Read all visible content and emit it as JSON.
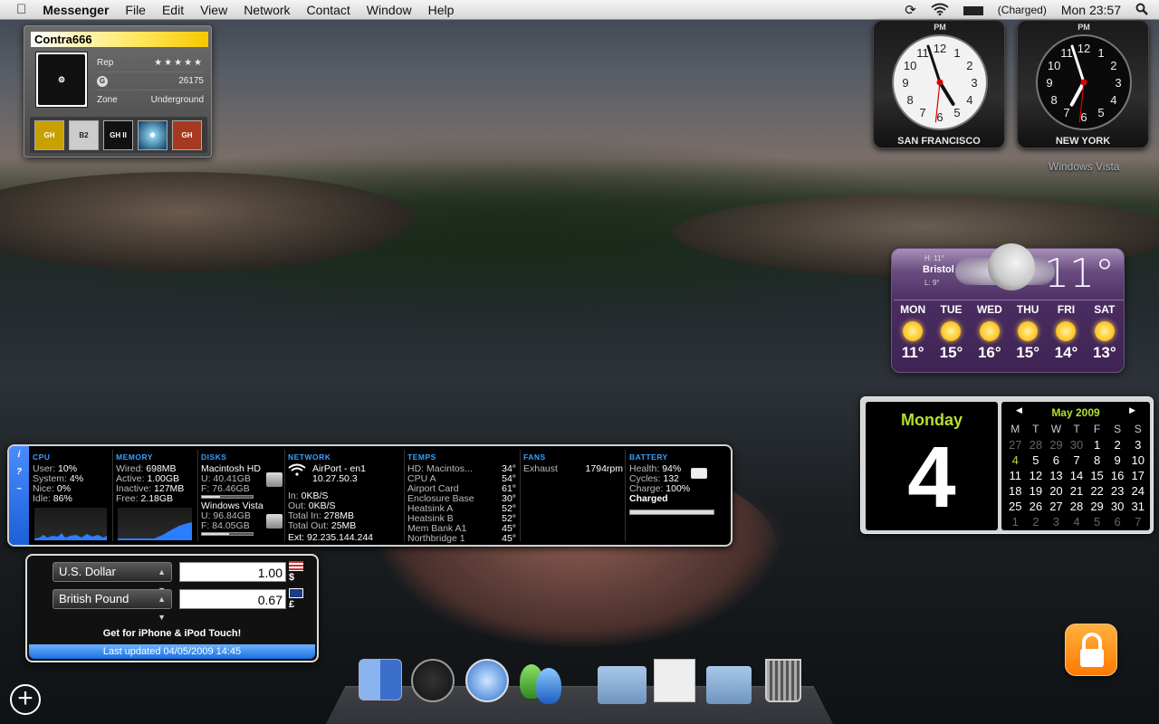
{
  "menubar": {
    "app": "Messenger",
    "items": [
      "File",
      "Edit",
      "View",
      "Network",
      "Contact",
      "Window",
      "Help"
    ],
    "battery": "(Charged)",
    "clock": "Mon 23:57"
  },
  "gamercard": {
    "gamertag": "Contra666",
    "rep_label": "Rep",
    "rep_stars": "★★★★★",
    "gamerscore_label": "G",
    "gamerscore": "26175",
    "zone_label": "Zone",
    "zone": "Underground",
    "games": [
      "GH World Tour",
      "B2",
      "GH II",
      "Halo",
      "GH"
    ]
  },
  "clocks": [
    {
      "city": "SAN FRANCISCO",
      "ampm": "PM",
      "hour": 16,
      "minute": 57,
      "second": 31
    },
    {
      "city": "NEW YORK",
      "ampm": "PM",
      "hour": 18,
      "minute": 57,
      "second": 31
    }
  ],
  "desktop_label": "Windows Vista",
  "weather": {
    "city": "Bristol",
    "high": "H: 11°",
    "low": "L: 9°",
    "temp": "11°",
    "forecast": [
      {
        "day": "MON",
        "temp": "11°"
      },
      {
        "day": "TUE",
        "temp": "15°"
      },
      {
        "day": "WED",
        "temp": "16°"
      },
      {
        "day": "THU",
        "temp": "15°"
      },
      {
        "day": "FRI",
        "temp": "14°"
      },
      {
        "day": "SAT",
        "temp": "13°"
      }
    ]
  },
  "calendar": {
    "day_name": "Monday",
    "date": "4",
    "month": "May 2009",
    "headers": [
      "M",
      "T",
      "W",
      "T",
      "F",
      "S",
      "S"
    ],
    "cells": [
      "27",
      "28",
      "29",
      "30",
      "1",
      "2",
      "3",
      "4",
      "5",
      "6",
      "7",
      "8",
      "9",
      "10",
      "11",
      "12",
      "13",
      "14",
      "15",
      "16",
      "17",
      "18",
      "19",
      "20",
      "21",
      "22",
      "23",
      "24",
      "25",
      "26",
      "27",
      "28",
      "29",
      "30",
      "31",
      "1",
      "2",
      "3",
      "4",
      "5",
      "6",
      "7"
    ],
    "dim_before": 4,
    "dim_after_from": 35,
    "today_index": 7
  },
  "istat": {
    "side": [
      "i",
      "?",
      "~"
    ],
    "cpu": {
      "title": "CPU",
      "rows": [
        [
          "User:",
          "10%"
        ],
        [
          "System:",
          "4%"
        ],
        [
          "Nice:",
          "0%"
        ],
        [
          "Idle:",
          "86%"
        ]
      ]
    },
    "memory": {
      "title": "MEMORY",
      "rows": [
        [
          "Wired:",
          "698MB"
        ],
        [
          "Active:",
          "1.00GB"
        ],
        [
          "Inactive:",
          "127MB"
        ],
        [
          "Free:",
          "2.18GB"
        ]
      ]
    },
    "disks": {
      "title": "DISKS",
      "disk1": {
        "name": "Macintosh HD",
        "used": "U: 40.41GB",
        "free": "F: 76.46GB",
        "fill": 0.35
      },
      "disk2": {
        "name": "Windows Vista",
        "used": "U: 96.84GB",
        "free": "F: 84.05GB",
        "fill": 0.53
      }
    },
    "network": {
      "title": "NETWORK",
      "interface": "AirPort - en1",
      "ip": "10.27.50.3",
      "rows": [
        [
          "In:",
          "0KB/S"
        ],
        [
          "Out:",
          "0KB/S"
        ],
        [
          "Total In:",
          "278MB"
        ],
        [
          "Total Out:",
          "25MB"
        ]
      ],
      "ext": "Ext: 92.235.144.244"
    },
    "temps": {
      "title": "TEMPS",
      "rows": [
        [
          "HD: Macintos...",
          "34°"
        ],
        [
          "CPU A",
          "54°"
        ],
        [
          "Airport Card",
          "61°"
        ],
        [
          "Enclosure Base",
          "30°"
        ],
        [
          "Heatsink A",
          "52°"
        ],
        [
          "Heatsink B",
          "52°"
        ],
        [
          "Mem Bank A1",
          "45°"
        ],
        [
          "Northbridge 1",
          "45°"
        ]
      ]
    },
    "fans": {
      "title": "FANS",
      "name": "Exhaust",
      "rpm": "1794rpm"
    },
    "battery": {
      "title": "BATTERY",
      "rows": [
        [
          "Health:",
          "94%"
        ],
        [
          "Cycles:",
          "132"
        ],
        [
          "Charge:",
          "100%"
        ]
      ],
      "status": "Charged",
      "level": 1.0
    }
  },
  "currency": {
    "from": "U.S. Dollar",
    "from_value": "1.00",
    "from_symbol": "$",
    "to": "British Pound",
    "to_value": "0.67",
    "to_symbol": "£",
    "promo": "Get for iPhone & iPod Touch!",
    "updated": "Last updated 04/05/2009 14:45"
  },
  "dock": [
    "Finder",
    "Dashboard",
    "Safari",
    "Messenger",
    "Utilities",
    "Preview",
    "Documents",
    "Trash"
  ],
  "colors": {
    "accent_green": "#b4e030",
    "istat_blue": "#3aa0ff",
    "lock_orange": "#ff8a10"
  }
}
